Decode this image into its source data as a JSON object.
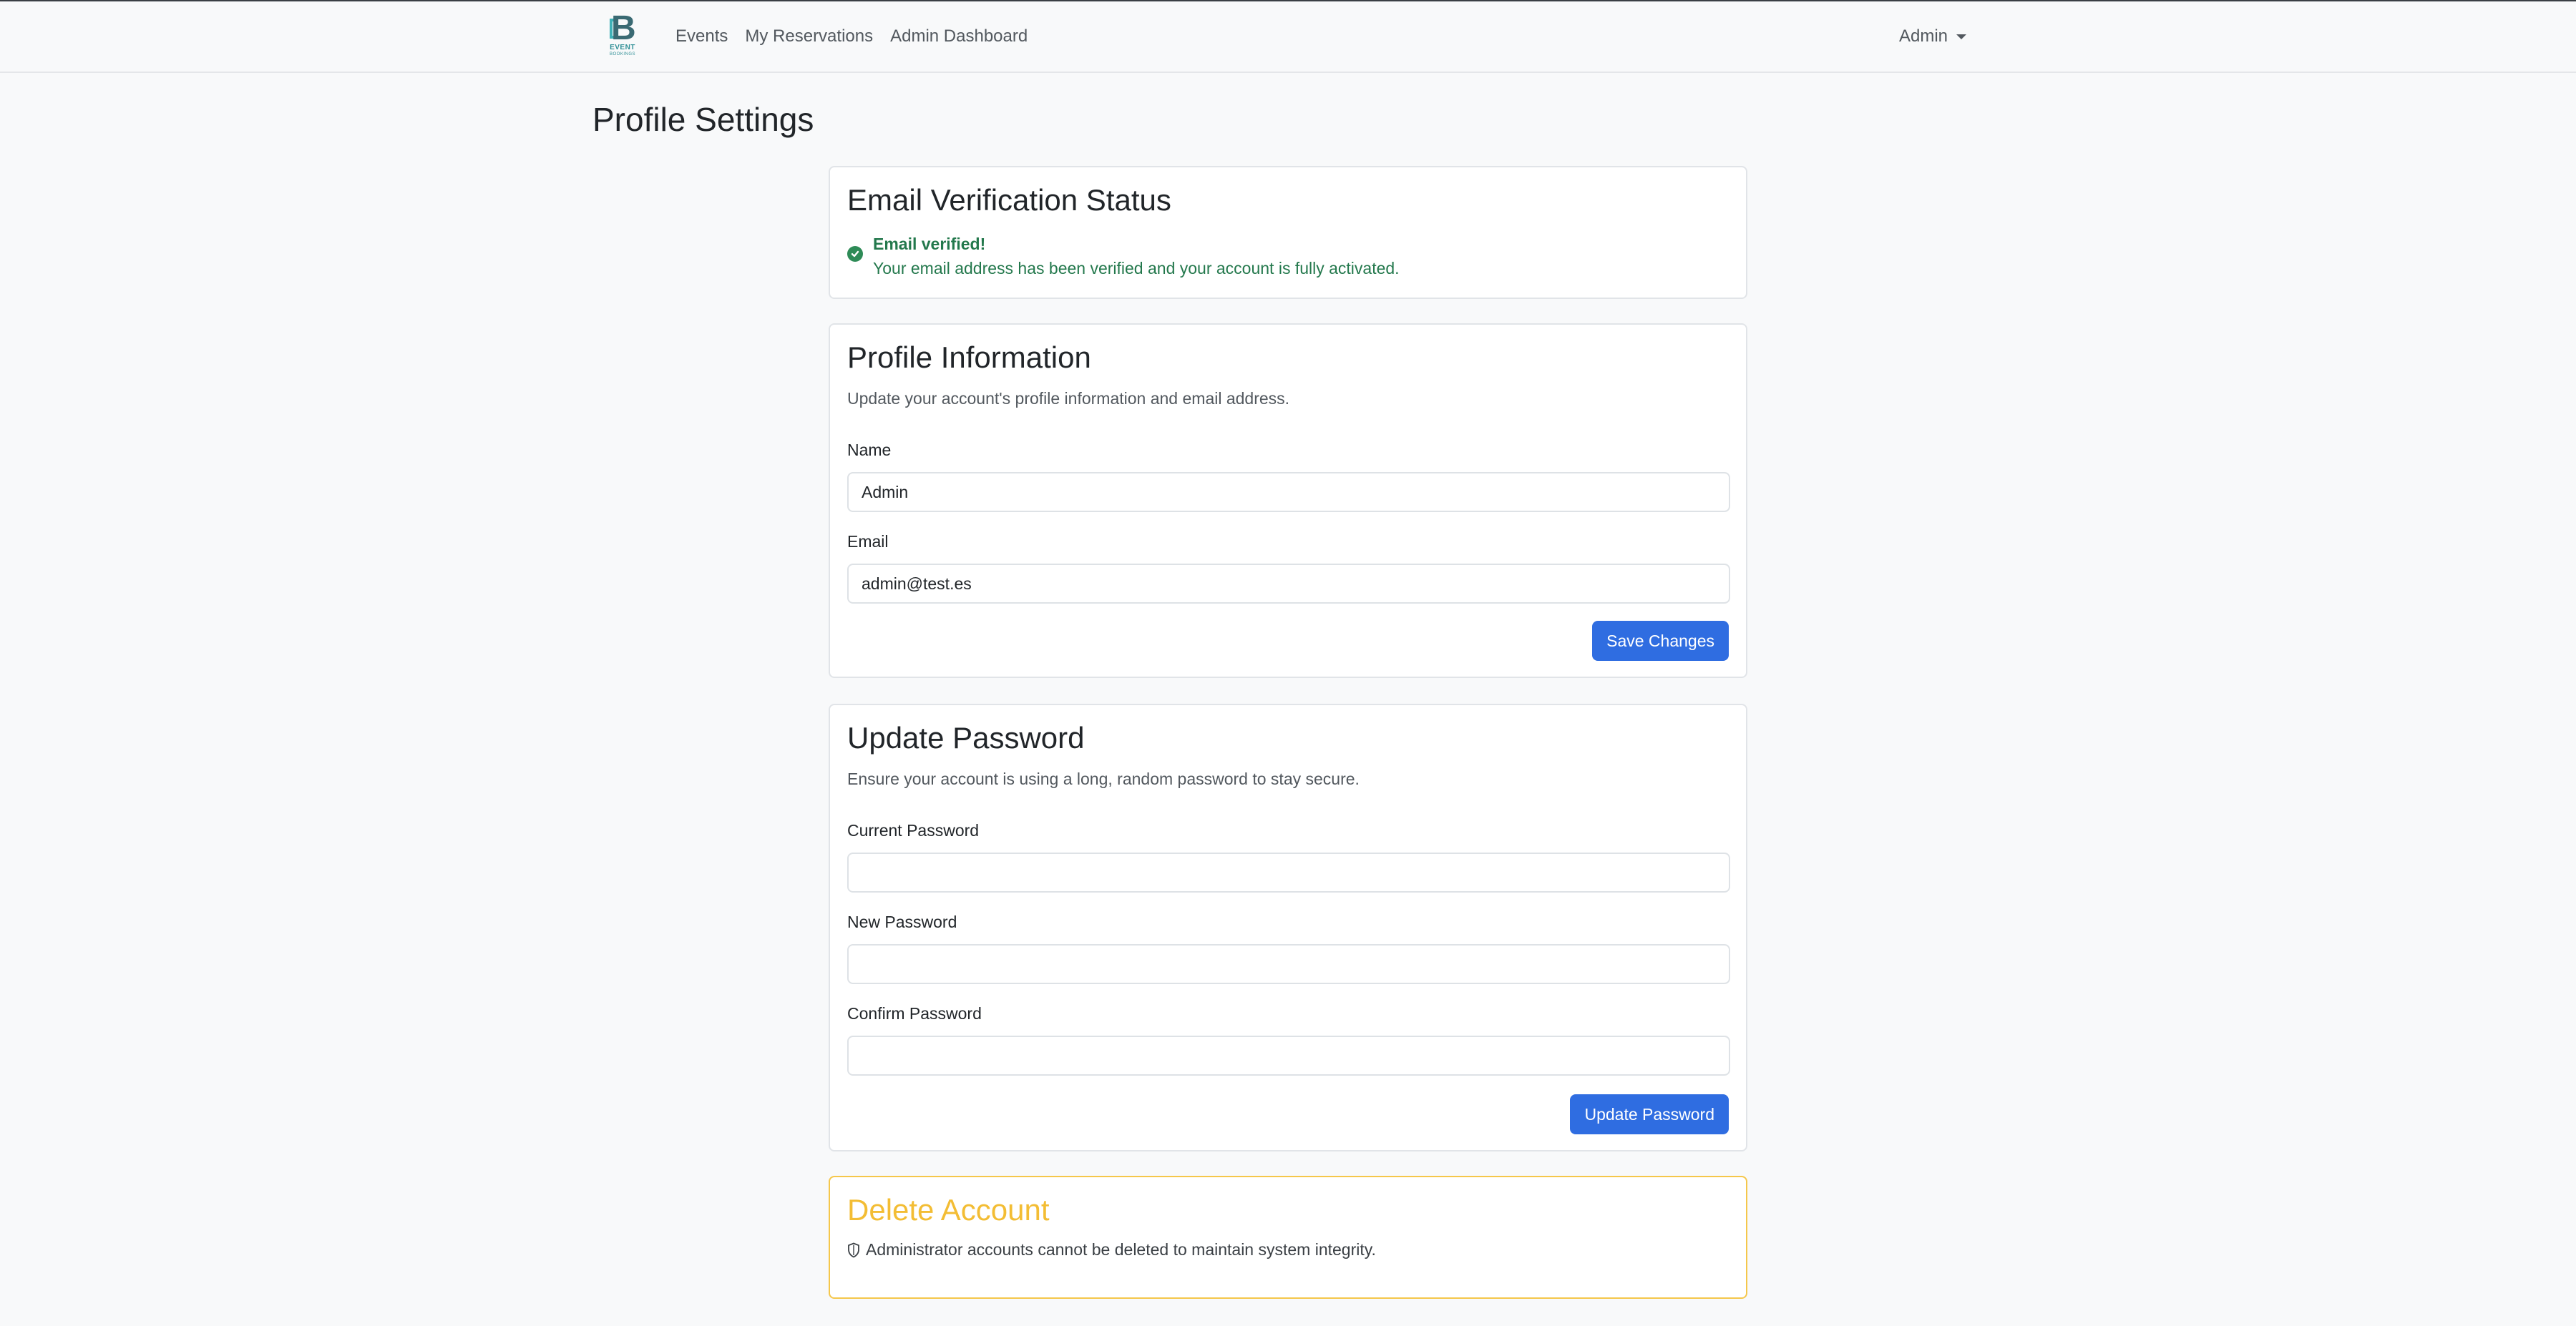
{
  "nav": {
    "logo_text": "EVENT",
    "logo_subtext": "BOOKINGS",
    "links": [
      "Events",
      "My Reservations",
      "Admin Dashboard"
    ],
    "user_menu": "Admin"
  },
  "page_title": "Profile Settings",
  "email_status": {
    "title": "Email Verification Status",
    "verified_heading": "Email verified!",
    "verified_message": "Your email address has been verified and your account is fully activated."
  },
  "profile": {
    "title": "Profile Information",
    "description": "Update your account's profile information and email address.",
    "name_label": "Name",
    "name_value": "Admin",
    "email_label": "Email",
    "email_value": "admin@test.es",
    "save_label": "Save Changes"
  },
  "password": {
    "title": "Update Password",
    "description": "Ensure your account is using a long, random password to stay secure.",
    "current_label": "Current Password",
    "new_label": "New Password",
    "confirm_label": "Confirm Password",
    "current_value": "",
    "new_value": "",
    "confirm_value": "",
    "button_label": "Update Password"
  },
  "delete": {
    "title": "Delete Account",
    "note": "Administrator accounts cannot be deleted to maintain system integrity."
  },
  "colors": {
    "primary": "#2f6de1",
    "success": "#23784c",
    "warning": "#f3bd34",
    "background": "#f8f9fa"
  }
}
